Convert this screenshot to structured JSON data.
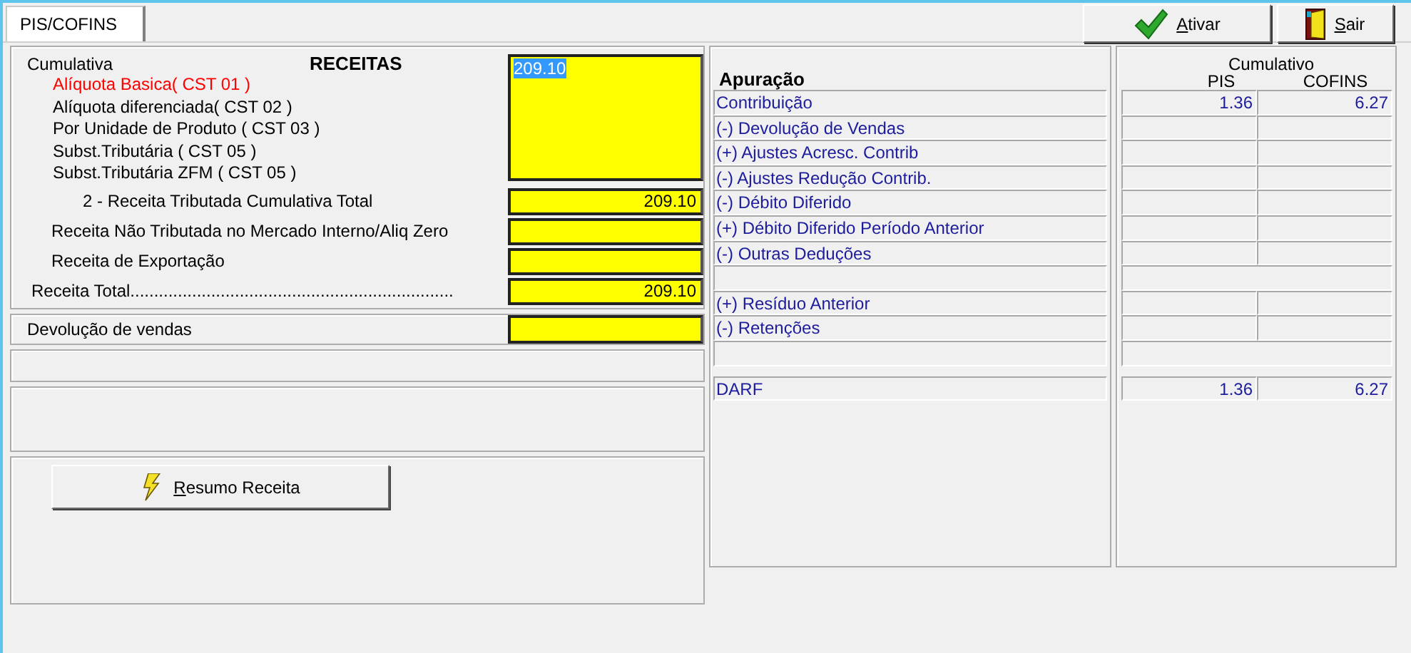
{
  "tab": {
    "label": "PIS/COFINS",
    "selected": true
  },
  "toolbar": [
    {
      "kind": "confirm",
      "label": "Ativar",
      "mnemonic_underlined": true
    },
    {
      "kind": "exit",
      "label": "Sair",
      "mnemonic_underlined": true
    }
  ],
  "receitas": {
    "regime": "Cumulativa",
    "title": "RECEITAS",
    "cst_lines": [
      {
        "label": "Alíquota Basica( CST 01 )",
        "active": true
      },
      {
        "label": "Alíquota diferenciada( CST 02 )",
        "active": false
      },
      {
        "label": "Por Unidade de Produto ( CST 03 )",
        "active": false
      },
      {
        "label": "Subst.Tributária ( CST 05 )",
        "active": false
      },
      {
        "label": "Subst.Tributária ZFM ( CST 05 )",
        "active": false
      }
    ],
    "cst_field": {
      "value": "209.10",
      "text_selected": true
    },
    "rows": [
      {
        "kind": "subtotal",
        "label": "2 - Receita Tributada Cumulativa Total",
        "value": "209.10"
      },
      {
        "kind": "item",
        "label": "Receita Não Tributada no Mercado Interno/Aliq Zero"
      },
      {
        "kind": "item",
        "label": "Receita de Exportação"
      },
      {
        "kind": "total",
        "label": "Receita Total....................................................................",
        "value": "209.10"
      }
    ]
  },
  "devolucao": {
    "label": "Devolução de vendas"
  },
  "resumo_button": {
    "label": "Resumo Receita",
    "mnemonic_underlined": true
  },
  "apuracao": {
    "title": "Apuração",
    "group_header": "Cumulativo",
    "columns": [
      "PIS",
      "COFINS"
    ],
    "rows": [
      {
        "kind": "line",
        "label": "Contribuição",
        "pis": "1.36",
        "cofins": "6.27"
      },
      {
        "kind": "line",
        "label": "(-) Devolução de Vendas"
      },
      {
        "kind": "line",
        "label": "(+) Ajustes Acresc. Contrib"
      },
      {
        "kind": "line",
        "label": "(-) Ajustes Redução Contrib."
      },
      {
        "kind": "line",
        "label": "(-) Débito Diferido"
      },
      {
        "kind": "line",
        "label": "(+) Débito Diferido Período  Anterior"
      },
      {
        "kind": "line",
        "label": "(-) Outras Deduções"
      },
      {
        "kind": "blank"
      },
      {
        "kind": "line",
        "label": "(+) Resíduo Anterior"
      },
      {
        "kind": "line",
        "label": "(-) Retenções"
      },
      {
        "kind": "blank"
      }
    ],
    "darf": {
      "label": "DARF",
      "pis": "1.36",
      "cofins": "6.27"
    }
  }
}
